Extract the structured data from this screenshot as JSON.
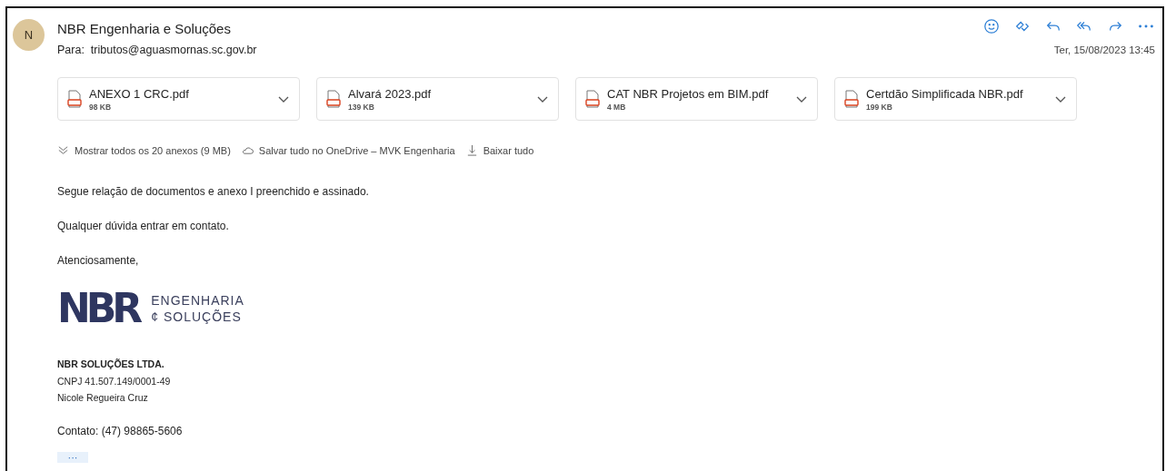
{
  "sender": {
    "initial": "N",
    "name": "NBR Engenharia e Soluções",
    "to_label": "Para:",
    "to": "tributos@aguasmornas.sc.gov.br",
    "date": "Ter, 15/08/2023 13:45"
  },
  "actions": [
    {
      "kind": "emoji"
    },
    {
      "kind": "loop"
    },
    {
      "kind": "reply"
    },
    {
      "kind": "reply_all"
    },
    {
      "kind": "forward"
    },
    {
      "kind": "more"
    }
  ],
  "attachments": [
    {
      "name": "ANEXO 1 CRC.pdf",
      "size": "98 KB"
    },
    {
      "name": "Alvará 2023.pdf",
      "size": "139 KB"
    },
    {
      "name": "CAT NBR Projetos em BIM.pdf",
      "size": "4 MB"
    },
    {
      "name": "Certdão Simplificada NBR.pdf",
      "size": "199 KB"
    }
  ],
  "attachment_links": [
    {
      "kind": "show_all",
      "label": "Mostrar todos os 20 anexos (9 MB)"
    },
    {
      "kind": "onedrive",
      "label": "Salvar tudo no OneDrive – MVK Engenharia"
    },
    {
      "kind": "download",
      "label": "Baixar tudo"
    }
  ],
  "body": [
    "Segue relação de documentos e anexo I preenchido e assinado.",
    "Qualquer dúvida entrar em contato.",
    "Atenciosamente,"
  ],
  "logo": {
    "mark": "NBR",
    "line1": "ENGENHARIA",
    "line2": "¢ SOLUÇÕES"
  },
  "signature": {
    "company": "NBR SOLUÇÕES LTDA.",
    "cnpj": "CNPJ 41.507.149/0001-49",
    "person": "Nicole Regueira Cruz",
    "contact": "Contato: (47) 98865-5606"
  },
  "expand_label": "···"
}
